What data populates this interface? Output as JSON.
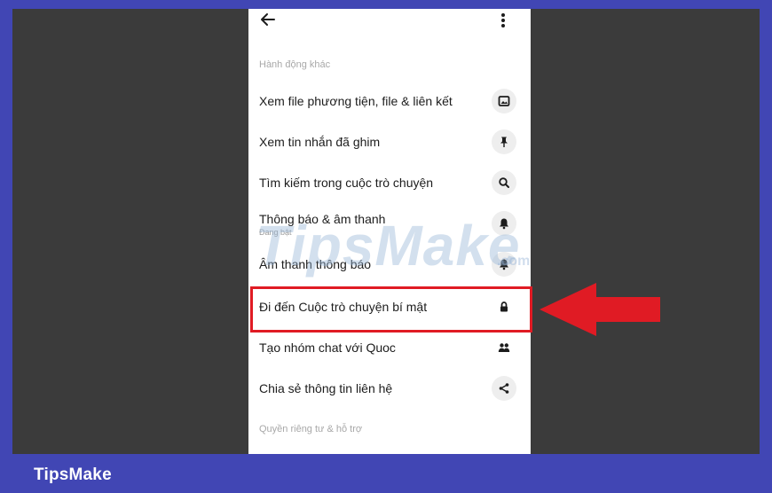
{
  "colors": {
    "frame": "#4146b4",
    "stage": "#3b3b3b",
    "highlight": "#e01b24",
    "arrow": "#e01b24",
    "icon_bg": "#eeeeee"
  },
  "footer": {
    "brand": "TipsMake"
  },
  "watermark": {
    "text": "TipsMake",
    "suffix": ".com"
  },
  "phone": {
    "topbar": {
      "back_icon": "arrow-left-icon",
      "more_icon": "more-vertical-icon"
    },
    "section_other_actions": "Hành động khác",
    "menu": [
      {
        "label": "Xem file phương tiện, file & liên kết",
        "icon": "image-icon"
      },
      {
        "label": "Xem tin nhắn đã ghim",
        "icon": "pin-icon"
      },
      {
        "label": "Tìm kiếm trong cuộc trò chuyện",
        "icon": "search-icon"
      },
      {
        "label": "Thông báo & âm thanh",
        "sublabel": "Đang bật",
        "icon": "bell-icon"
      },
      {
        "label": "Âm thanh thông báo",
        "icon": "bell-icon"
      },
      {
        "label": "Đi đến Cuộc trò chuyện bí mật",
        "icon": "lock-icon",
        "highlighted": true
      },
      {
        "label": "Tạo nhóm chat với Quoc",
        "icon": "people-icon"
      },
      {
        "label": "Chia sẻ thông tin liên hệ",
        "icon": "share-icon"
      }
    ],
    "section_privacy": "Quyền riêng tư & hỗ trợ"
  }
}
